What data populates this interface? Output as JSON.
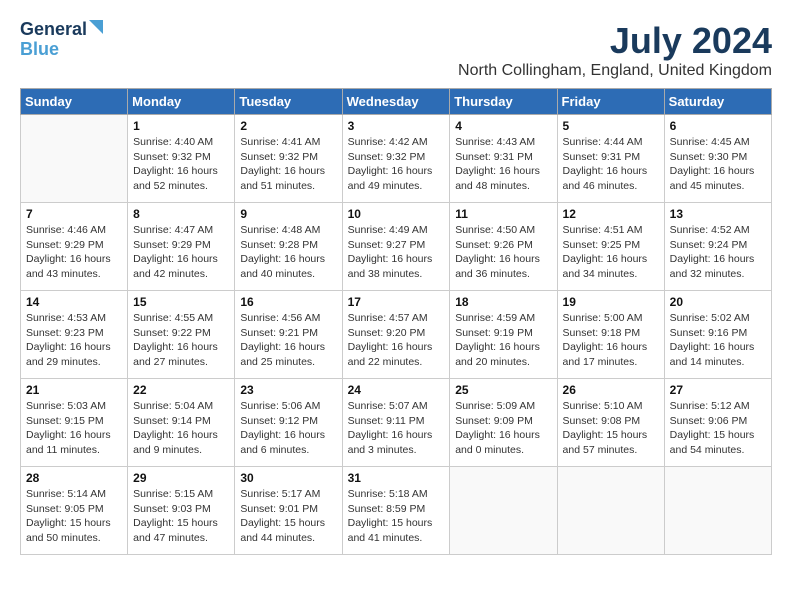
{
  "logo": {
    "line1": "General",
    "line2": "Blue"
  },
  "title": {
    "month_year": "July 2024",
    "location": "North Collingham, England, United Kingdom"
  },
  "headers": [
    "Sunday",
    "Monday",
    "Tuesday",
    "Wednesday",
    "Thursday",
    "Friday",
    "Saturday"
  ],
  "weeks": [
    [
      {
        "day": "",
        "info": ""
      },
      {
        "day": "1",
        "info": "Sunrise: 4:40 AM\nSunset: 9:32 PM\nDaylight: 16 hours\nand 52 minutes."
      },
      {
        "day": "2",
        "info": "Sunrise: 4:41 AM\nSunset: 9:32 PM\nDaylight: 16 hours\nand 51 minutes."
      },
      {
        "day": "3",
        "info": "Sunrise: 4:42 AM\nSunset: 9:32 PM\nDaylight: 16 hours\nand 49 minutes."
      },
      {
        "day": "4",
        "info": "Sunrise: 4:43 AM\nSunset: 9:31 PM\nDaylight: 16 hours\nand 48 minutes."
      },
      {
        "day": "5",
        "info": "Sunrise: 4:44 AM\nSunset: 9:31 PM\nDaylight: 16 hours\nand 46 minutes."
      },
      {
        "day": "6",
        "info": "Sunrise: 4:45 AM\nSunset: 9:30 PM\nDaylight: 16 hours\nand 45 minutes."
      }
    ],
    [
      {
        "day": "7",
        "info": "Sunrise: 4:46 AM\nSunset: 9:29 PM\nDaylight: 16 hours\nand 43 minutes."
      },
      {
        "day": "8",
        "info": "Sunrise: 4:47 AM\nSunset: 9:29 PM\nDaylight: 16 hours\nand 42 minutes."
      },
      {
        "day": "9",
        "info": "Sunrise: 4:48 AM\nSunset: 9:28 PM\nDaylight: 16 hours\nand 40 minutes."
      },
      {
        "day": "10",
        "info": "Sunrise: 4:49 AM\nSunset: 9:27 PM\nDaylight: 16 hours\nand 38 minutes."
      },
      {
        "day": "11",
        "info": "Sunrise: 4:50 AM\nSunset: 9:26 PM\nDaylight: 16 hours\nand 36 minutes."
      },
      {
        "day": "12",
        "info": "Sunrise: 4:51 AM\nSunset: 9:25 PM\nDaylight: 16 hours\nand 34 minutes."
      },
      {
        "day": "13",
        "info": "Sunrise: 4:52 AM\nSunset: 9:24 PM\nDaylight: 16 hours\nand 32 minutes."
      }
    ],
    [
      {
        "day": "14",
        "info": "Sunrise: 4:53 AM\nSunset: 9:23 PM\nDaylight: 16 hours\nand 29 minutes."
      },
      {
        "day": "15",
        "info": "Sunrise: 4:55 AM\nSunset: 9:22 PM\nDaylight: 16 hours\nand 27 minutes."
      },
      {
        "day": "16",
        "info": "Sunrise: 4:56 AM\nSunset: 9:21 PM\nDaylight: 16 hours\nand 25 minutes."
      },
      {
        "day": "17",
        "info": "Sunrise: 4:57 AM\nSunset: 9:20 PM\nDaylight: 16 hours\nand 22 minutes."
      },
      {
        "day": "18",
        "info": "Sunrise: 4:59 AM\nSunset: 9:19 PM\nDaylight: 16 hours\nand 20 minutes."
      },
      {
        "day": "19",
        "info": "Sunrise: 5:00 AM\nSunset: 9:18 PM\nDaylight: 16 hours\nand 17 minutes."
      },
      {
        "day": "20",
        "info": "Sunrise: 5:02 AM\nSunset: 9:16 PM\nDaylight: 16 hours\nand 14 minutes."
      }
    ],
    [
      {
        "day": "21",
        "info": "Sunrise: 5:03 AM\nSunset: 9:15 PM\nDaylight: 16 hours\nand 11 minutes."
      },
      {
        "day": "22",
        "info": "Sunrise: 5:04 AM\nSunset: 9:14 PM\nDaylight: 16 hours\nand 9 minutes."
      },
      {
        "day": "23",
        "info": "Sunrise: 5:06 AM\nSunset: 9:12 PM\nDaylight: 16 hours\nand 6 minutes."
      },
      {
        "day": "24",
        "info": "Sunrise: 5:07 AM\nSunset: 9:11 PM\nDaylight: 16 hours\nand 3 minutes."
      },
      {
        "day": "25",
        "info": "Sunrise: 5:09 AM\nSunset: 9:09 PM\nDaylight: 16 hours\nand 0 minutes."
      },
      {
        "day": "26",
        "info": "Sunrise: 5:10 AM\nSunset: 9:08 PM\nDaylight: 15 hours\nand 57 minutes."
      },
      {
        "day": "27",
        "info": "Sunrise: 5:12 AM\nSunset: 9:06 PM\nDaylight: 15 hours\nand 54 minutes."
      }
    ],
    [
      {
        "day": "28",
        "info": "Sunrise: 5:14 AM\nSunset: 9:05 PM\nDaylight: 15 hours\nand 50 minutes."
      },
      {
        "day": "29",
        "info": "Sunrise: 5:15 AM\nSunset: 9:03 PM\nDaylight: 15 hours\nand 47 minutes."
      },
      {
        "day": "30",
        "info": "Sunrise: 5:17 AM\nSunset: 9:01 PM\nDaylight: 15 hours\nand 44 minutes."
      },
      {
        "day": "31",
        "info": "Sunrise: 5:18 AM\nSunset: 8:59 PM\nDaylight: 15 hours\nand 41 minutes."
      },
      {
        "day": "",
        "info": ""
      },
      {
        "day": "",
        "info": ""
      },
      {
        "day": "",
        "info": ""
      }
    ]
  ]
}
